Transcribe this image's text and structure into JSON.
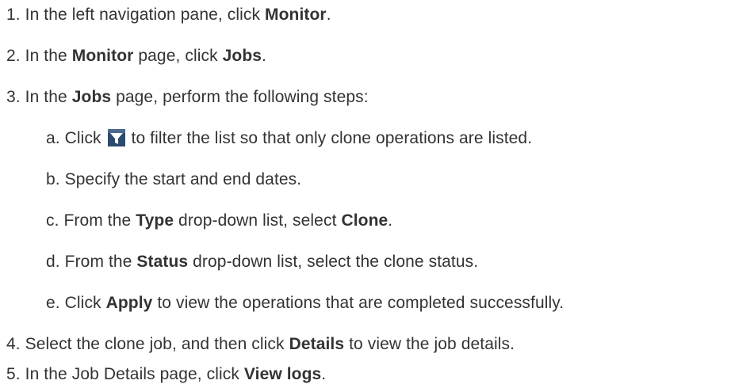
{
  "steps": [
    {
      "number": "1.",
      "text1": "In the left navigation pane, click ",
      "bold1": "Monitor",
      "text2": "."
    },
    {
      "number": "2.",
      "text1": "In the ",
      "bold1": "Monitor",
      "text2": " page, click ",
      "bold2": "Jobs",
      "text3": "."
    },
    {
      "number": "3.",
      "text1": "In the ",
      "bold1": "Jobs",
      "text2": " page, perform the following steps:"
    },
    {
      "number": "4.",
      "text1": "Select the clone job, and then click ",
      "bold1": "Details",
      "text2": " to view the job details."
    },
    {
      "number": "5.",
      "text1": "In the Job Details page, click ",
      "bold1": "View logs",
      "text2": "."
    }
  ],
  "substeps": [
    {
      "letter": "a.",
      "text1": "Click ",
      "icon": "filter-icon",
      "text2": " to filter the list so that only clone operations are listed."
    },
    {
      "letter": "b.",
      "text1": "Specify the start and end dates."
    },
    {
      "letter": "c.",
      "text1": "From the ",
      "bold1": "Type",
      "text2": " drop-down list, select ",
      "bold2": "Clone",
      "text3": "."
    },
    {
      "letter": "d.",
      "text1": "From the ",
      "bold1": "Status",
      "text2": " drop-down list, select the clone status."
    },
    {
      "letter": "e.",
      "text1": "Click ",
      "bold1": "Apply",
      "text2": " to view the operations that are completed successfully."
    }
  ],
  "colors": {
    "text": "#333333",
    "filter_icon_bg": "#2d4a6b",
    "filter_icon_fg": "#ffffff"
  }
}
